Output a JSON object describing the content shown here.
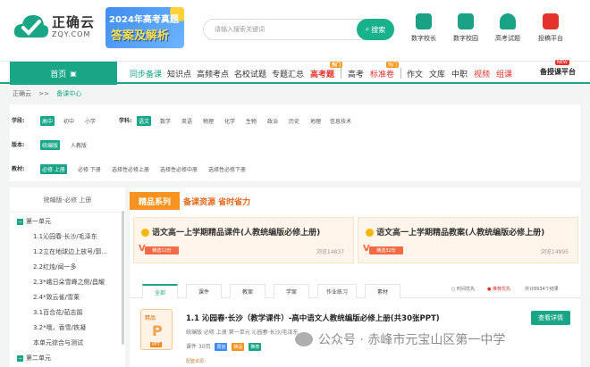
{
  "header": {
    "logo_cn": "正确云",
    "logo_en": "ZQY.COM",
    "banner_line1": "2024年高考真题",
    "banner_line2": "答案及解析",
    "search_placeholder": "请输入搜索关键词",
    "search_button": "搜索",
    "icons": [
      {
        "label": "数字校长",
        "icon": "principal-icon"
      },
      {
        "label": "数字校园",
        "icon": "campus-icon"
      },
      {
        "label": "高考试题",
        "icon": "exam-icon"
      },
      {
        "label": "投稿平台",
        "icon": "submit-icon"
      }
    ]
  },
  "nav": {
    "home": "首页",
    "items": [
      "同步备课",
      "知识点",
      "高频考点",
      "名校试题",
      "专题汇总",
      "高考题",
      "高考",
      "标准卷",
      "作文",
      "文库",
      "中职",
      "视频",
      "组课"
    ],
    "badge_hot": "热门",
    "platform": "备授课平台",
    "platform_badge": "NEW"
  },
  "breadcrumb": {
    "root": "正确云",
    "sep": ">>",
    "current": "备课中心"
  },
  "filters": {
    "stage_label": "学段:",
    "stages": [
      "高中",
      "初中",
      "小学"
    ],
    "subject_label": "学科:",
    "subjects": [
      "语文",
      "数学",
      "英语",
      "物理",
      "化学",
      "生物",
      "政治",
      "历史",
      "地理",
      "信息技术"
    ],
    "version_label": "版本:",
    "versions": [
      "统编版",
      "人教版"
    ],
    "book_label": "教材:",
    "books": [
      "必修 上册",
      "必修 下册",
      "选择性必修上册",
      "选择性必修中册",
      "选择性必修下册"
    ]
  },
  "sidebar": {
    "header": "统编版-必修 上册",
    "unit1": "第一单元",
    "items": [
      "1.1沁园春·长沙/毛泽东",
      "1.2立在地球边上放号/郭...",
      "2.2红烛/闻一多",
      "2.3*峨日朵雪峰之侧/昌耀",
      "2.4*致云雀/雪莱",
      "3.1百合花/茹志鹃",
      "3.2*哦，香雪/铁凝",
      "本单元综合与测试"
    ],
    "unit2": "第二单元"
  },
  "main": {
    "section_tag": "精品系列",
    "section_sub": "备课资源 省时省力",
    "cards": [
      {
        "title": "语文高一上学期精品课件(人教统编版必修上册)",
        "tag": "精选12份",
        "views": "浏览14837"
      },
      {
        "title": "语文高一上学期精品教案(人教统编版必修上册)",
        "tag": "精选32份",
        "views": "浏览14895"
      }
    ],
    "tabs": [
      "全部",
      "课件",
      "教案",
      "学案",
      "作业练习",
      "素材"
    ],
    "sort_time": "时间优先",
    "sort_rec": "推荐优先",
    "total": "共计8934个结果",
    "result": {
      "ppt_label": "精品",
      "ppt_tag": "PPT",
      "title": "1.1 沁园春·长沙（教学课件）-高中语文人教统编版必修上册(共30张PPT)",
      "meta": "统编版   必修 上册   第一单元   沁园春·长沙/毛泽东",
      "price": "课件 30页",
      "chips": [
        "原创",
        "精品",
        "推荐"
      ],
      "extra": "配套资源：",
      "button": "查看详情"
    }
  },
  "watermark": "公众号 · 赤峰市元宝山区第一中学",
  "colors": {
    "accent": "#19a687",
    "orange": "#f7931e",
    "red": "#e5322d"
  }
}
